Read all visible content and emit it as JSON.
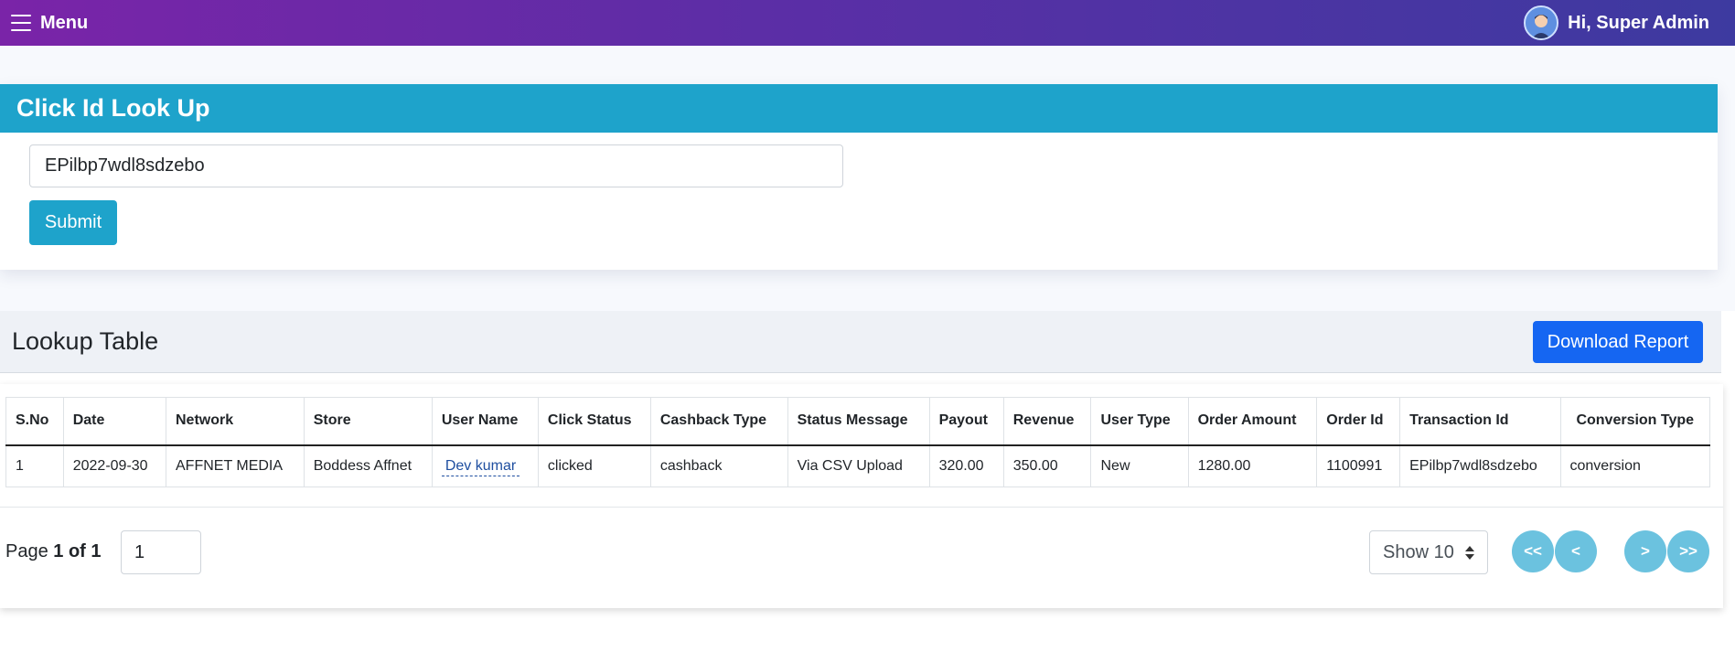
{
  "topbar": {
    "menu_label": "Menu",
    "greeting": "Hi, Super Admin",
    "gradient_start": "#7a24a8",
    "gradient_end": "#3d3aa0"
  },
  "lookup": {
    "title": "Click Id Look Up",
    "input_value": "EPilbp7wdl8sdzebo",
    "submit_label": "Submit",
    "header_color": "#1ea3cb"
  },
  "table_section": {
    "title": "Lookup Table",
    "download_label": "Download Report",
    "columns": [
      "S.No",
      "Date",
      "Network",
      "Store",
      "User Name",
      "Click Status",
      "Cashback Type",
      "Status Message",
      "Payout",
      "Revenue",
      "User Type",
      "Order Amount",
      "Order Id",
      "Transaction Id",
      "Conversion Type"
    ],
    "rows": [
      [
        "1",
        "2022-09-30",
        "AFFNET MEDIA",
        "Boddess Affnet",
        "Dev kumar",
        "clicked",
        "cashback",
        "Via CSV Upload",
        "320.00",
        "350.00",
        "New",
        "1280.00",
        "1100991",
        "EPilbp7wdl8sdzebo",
        "conversion"
      ]
    ]
  },
  "pagination": {
    "page_prefix": "Page",
    "page_status": "1 of 1",
    "page_input": "1",
    "show_label": "Show 10",
    "first": "<<",
    "prev": "<",
    "next": ">",
    "last": ">>"
  }
}
